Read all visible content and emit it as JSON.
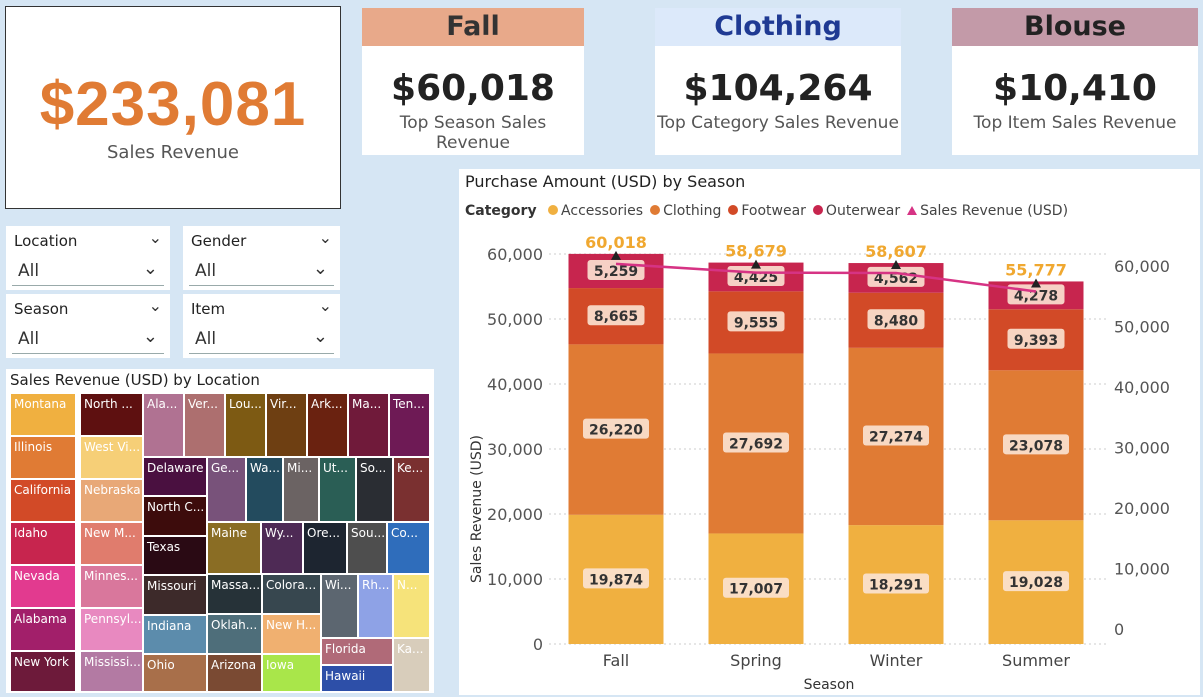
{
  "kpis": {
    "main": {
      "value": "$233,081",
      "label": "Sales Revenue"
    },
    "season": {
      "head": "Fall",
      "value": "$60,018",
      "label": "Top Season Sales Revenue",
      "color": "#e8a98a",
      "text_color": "#333333"
    },
    "category": {
      "head": "Clothing",
      "value": "$104,264",
      "label": "Top Category Sales Revenue",
      "color": "#dce9fa",
      "text_color": "#1f3a93"
    },
    "item": {
      "head": "Blouse",
      "value": "$10,410",
      "label": "Top Item Sales Revenue",
      "color": "#c39aa8",
      "text_color": "#222222"
    }
  },
  "slicers": {
    "location": {
      "title": "Location",
      "value": "All"
    },
    "gender": {
      "title": "Gender",
      "value": "All"
    },
    "season": {
      "title": "Season",
      "value": "All"
    },
    "item": {
      "title": "Item",
      "value": "All"
    }
  },
  "treemap": {
    "title": "Sales Revenue (USD) by Location",
    "tiles": [
      {
        "label": "Montana",
        "color": "#f0b040"
      },
      {
        "label": "Illinois",
        "color": "#e07b34"
      },
      {
        "label": "California",
        "color": "#d24a27"
      },
      {
        "label": "Idaho",
        "color": "#c7254e"
      },
      {
        "label": "Nevada",
        "color": "#e23a8f"
      },
      {
        "label": "Alabama",
        "color": "#a21f6a"
      },
      {
        "label": "New York",
        "color": "#6d1a3a"
      },
      {
        "label": "North ...",
        "color": "#5e1010"
      },
      {
        "label": "West Vi...",
        "color": "#f6cf77"
      },
      {
        "label": "Nebraska",
        "color": "#e8a877"
      },
      {
        "label": "New M...",
        "color": "#e07c6d"
      },
      {
        "label": "Minnes...",
        "color": "#d9779c"
      },
      {
        "label": "Pennsyl...",
        "color": "#e889c0"
      },
      {
        "label": "Mississi...",
        "color": "#b37aa3"
      },
      {
        "label": "Ala...",
        "color": "#b07292"
      },
      {
        "label": "Ver...",
        "color": "#ad6f6f"
      },
      {
        "label": "Lou...",
        "color": "#7d5a13"
      },
      {
        "label": "Vir...",
        "color": "#6e3f12"
      },
      {
        "label": "Ark...",
        "color": "#6a2210"
      },
      {
        "label": "Ma...",
        "color": "#701a3a"
      },
      {
        "label": "Ten...",
        "color": "#6e1a55"
      },
      {
        "label": "Delaware",
        "color": "#4a1040"
      },
      {
        "label": "North C...",
        "color": "#3d0c0c"
      },
      {
        "label": "Texas",
        "color": "#2a0a14"
      },
      {
        "label": "Ge...",
        "color": "#78527a"
      },
      {
        "label": "Wa...",
        "color": "#234b5e"
      },
      {
        "label": "Mi...",
        "color": "#6b6363"
      },
      {
        "label": "Ut...",
        "color": "#2a5e55"
      },
      {
        "label": "So...",
        "color": "#2a2d33"
      },
      {
        "label": "Ke...",
        "color": "#7a3030"
      },
      {
        "label": "Maine",
        "color": "#8a6d24"
      },
      {
        "label": "Wy...",
        "color": "#4e2a55"
      },
      {
        "label": "Ore...",
        "color": "#1d2530"
      },
      {
        "label": "Sou...",
        "color": "#4e4e4e"
      },
      {
        "label": "Co...",
        "color": "#2f6dbb"
      },
      {
        "label": "Missouri",
        "color": "#3d2a2a"
      },
      {
        "label": "Massa...",
        "color": "#263238"
      },
      {
        "label": "Colora...",
        "color": "#37474f"
      },
      {
        "label": "Wi...",
        "color": "#5c6670"
      },
      {
        "label": "Rh...",
        "color": "#8ea2e6"
      },
      {
        "label": "N...",
        "color": "#f6e37a"
      },
      {
        "label": "Indiana",
        "color": "#5c8cac"
      },
      {
        "label": "Oklah...",
        "color": "#4e6e7a"
      },
      {
        "label": "New H...",
        "color": "#f0b070"
      },
      {
        "label": "Ohio",
        "color": "#a86f4a"
      },
      {
        "label": "Arizona",
        "color": "#7a4a33"
      },
      {
        "label": "Iowa",
        "color": "#a9e64a"
      },
      {
        "label": "Florida",
        "color": "#b06a78"
      },
      {
        "label": "Hawaii",
        "color": "#2d4fa8"
      },
      {
        "label": "Ka...",
        "color": "#d8cdbb"
      }
    ]
  },
  "chart_data": {
    "type": "bar",
    "title": "Purchase Amount (USD) by Season",
    "legend_title": "Category",
    "xlabel": "Season",
    "ylabel": "Sales Revenue (USD)",
    "categories": [
      "Fall",
      "Spring",
      "Winter",
      "Summer"
    ],
    "stacked": true,
    "series": [
      {
        "name": "Accessories",
        "values": [
          19874,
          17007,
          18291,
          19028
        ],
        "color": "#f0b040",
        "labels": [
          "19,874",
          "17,007",
          "18,291",
          "19,028"
        ]
      },
      {
        "name": "Clothing",
        "values": [
          26220,
          27692,
          27274,
          23078
        ],
        "color": "#e07b34",
        "labels": [
          "26,220",
          "27,692",
          "27,274",
          "23,078"
        ]
      },
      {
        "name": "Footwear",
        "values": [
          8665,
          9555,
          8480,
          9393
        ],
        "color": "#d24a27",
        "labels": [
          "8,665",
          "9,555",
          "8,480",
          "9,393"
        ]
      },
      {
        "name": "Outerwear",
        "values": [
          5259,
          4425,
          4562,
          4278
        ],
        "color": "#c7254e",
        "labels": [
          "5,259",
          "4,425",
          "4,562",
          "4,278"
        ]
      }
    ],
    "line": {
      "name": "Sales Revenue (USD)",
      "values": [
        60018,
        58679,
        58607,
        55777
      ],
      "color": "#d63384"
    },
    "totals": [
      "60,018",
      "58,679",
      "58,607",
      "55,777"
    ],
    "totals_color": "#f0a830",
    "ylim": [
      0,
      60000
    ],
    "yticks": [
      "0",
      "10,000",
      "20,000",
      "30,000",
      "40,000",
      "50,000",
      "60,000"
    ],
    "y2ticks": [
      "0",
      "10,000",
      "20,000",
      "30,000",
      "40,000",
      "50,000",
      "60,000"
    ],
    "grid": true,
    "legend_position": "top-left"
  }
}
